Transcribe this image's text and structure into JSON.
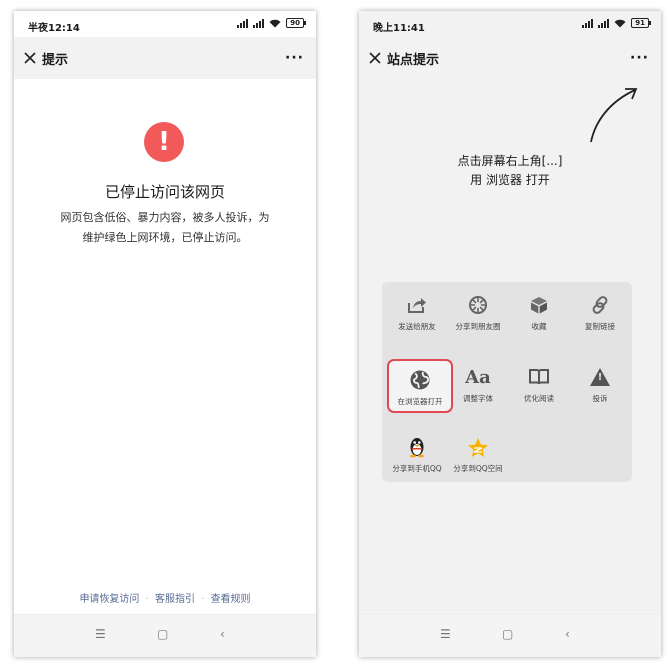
{
  "left_phone": {
    "status": {
      "time": "半夜12:14",
      "battery": "90"
    },
    "title": "提示",
    "more": "···",
    "warning_symbol": "!",
    "heading": "已停止访问该网页",
    "description_line1": "网页包含低俗、暴力内容，被多人投诉，为",
    "description_line2": "维护绿色上网环境，已停止访问。",
    "links": [
      "申请恢复访问",
      "客服指引",
      "查看规则"
    ],
    "link_separator": "·",
    "nav": {
      "menu": "☰",
      "home": "▢",
      "back": "‹"
    }
  },
  "right_phone": {
    "status": {
      "time": "晚上11:41",
      "battery": "91"
    },
    "title": "站点提示",
    "more": "···",
    "hint_line1": "点击屏幕右上角[...]",
    "hint_line2": "用 浏览器 打开",
    "menu_items": [
      {
        "label": "发送给朋友",
        "icon": "share-icon"
      },
      {
        "label": "分享到朋友圈",
        "icon": "moments-icon"
      },
      {
        "label": "收藏",
        "icon": "favorite-cube-icon"
      },
      {
        "label": "复制链接",
        "icon": "link-icon"
      },
      {
        "label": "在浏览器打开",
        "icon": "globe-icon",
        "highlight": true
      },
      {
        "label": "调整字体",
        "icon": "font-icon",
        "glyph": "Aa"
      },
      {
        "label": "优化阅读",
        "icon": "book-icon"
      },
      {
        "label": "投诉",
        "icon": "warning-icon",
        "glyph": "!"
      },
      {
        "label": "分享到手机QQ",
        "icon": "qq-penguin-icon"
      },
      {
        "label": "分享到QQ空间",
        "icon": "qzone-star-icon"
      }
    ],
    "highlight_color": "#e04a55",
    "nav": {
      "menu": "☰",
      "home": "▢",
      "back": "‹"
    }
  },
  "colors": {
    "warning_red": "#f25a5a",
    "link_blue": "#576b95"
  }
}
